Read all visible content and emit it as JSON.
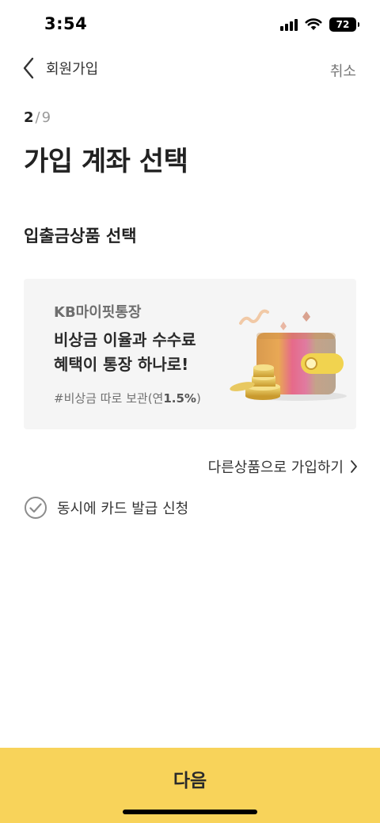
{
  "status_bar": {
    "time": "3:54",
    "battery": "72",
    "icons": [
      "signal-icon",
      "wifi-icon",
      "battery-icon"
    ]
  },
  "nav": {
    "back_icon": "chevron-left-icon",
    "back_label": "회원가입",
    "cancel_label": "취소"
  },
  "step": {
    "current": "2",
    "separator": "/",
    "total": "9"
  },
  "page_title": "가입 계좌 선택",
  "section_title": "입출금상품 선택",
  "product_card": {
    "name": "KB마이핏통장",
    "headline_line1": "비상금 이율과 수수료",
    "headline_line2": "혜택이 통장 하나로!",
    "tag_prefix": "#비상금 따로 보관(연",
    "tag_rate": "1.5%",
    "tag_suffix": ")",
    "illustration": "wallet-with-coins-illustration"
  },
  "other_products_link": {
    "label": "다른상품으로 가입하기",
    "icon": "chevron-right-icon"
  },
  "card_issue_option": {
    "label": "동시에 카드 발급 신청",
    "icon": "check-circle-icon",
    "checked": false
  },
  "next_button": {
    "label": "다음"
  },
  "colors": {
    "accent": "#f8d35a",
    "card_bg": "#f5f5f5",
    "muted_text": "#9a9a9a"
  }
}
